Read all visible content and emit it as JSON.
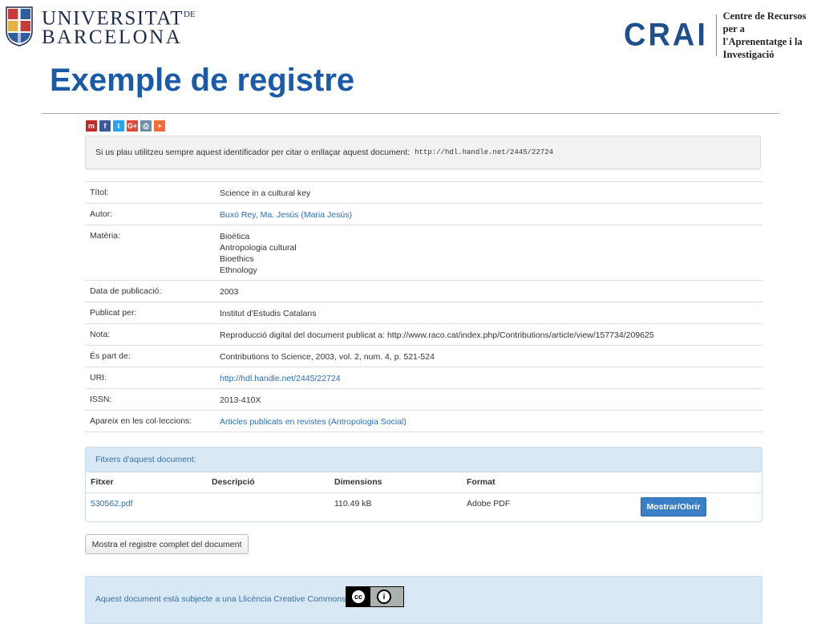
{
  "header": {
    "ub_line1": "UNIVERSITAT",
    "ub_de": "DE",
    "ub_line2": "BARCELONA",
    "crai_word": "CRAI",
    "crai_sub1": "Centre de Recursos per a",
    "crai_sub2": "l'Aprenentatge i la Investigació"
  },
  "title": "Exemple de registre",
  "share_icons": [
    {
      "name": "mendeley-icon",
      "glyph": "m",
      "color": "#c02a2a"
    },
    {
      "name": "facebook-icon",
      "glyph": "f",
      "color": "#3b5998"
    },
    {
      "name": "twitter-icon",
      "glyph": "t",
      "color": "#2aa3ef"
    },
    {
      "name": "googleplus-icon",
      "glyph": "G+",
      "color": "#dd4b39"
    },
    {
      "name": "print-icon",
      "glyph": "⎙",
      "color": "#6b8fa6"
    },
    {
      "name": "more-icon",
      "glyph": "+",
      "color": "#f26b38"
    }
  ],
  "identifier": {
    "text": "Si us plau utilitzeu sempre aquest identificador per citar o enllaçar aquest document:",
    "url": "http://hdl.handle.net/2445/22724"
  },
  "metadata": [
    {
      "label": "Títol:",
      "values": [
        "Science in a cultural key"
      ]
    },
    {
      "label": "Autor:",
      "values": [
        "Buxó Rey, Ma. Jesús (Maria Jesús)"
      ],
      "link": true
    },
    {
      "label": "Matèria:",
      "values": [
        "Bioètica",
        "Antropologia cultural",
        "Bioethics",
        "Ethnology"
      ]
    },
    {
      "label": "Data de publicació:",
      "values": [
        "2003"
      ]
    },
    {
      "label": "Publicat per:",
      "values": [
        "Institut d'Estudis Catalans"
      ]
    },
    {
      "label": "Nota:",
      "values": [
        "Reproducció digital del document publicat a: http://www.raco.cat/index.php/Contributions/article/view/157734/209625"
      ]
    },
    {
      "label": "És part de:",
      "values": [
        "Contributions to Science, 2003, vol. 2, num. 4, p. 521-524"
      ]
    },
    {
      "label": "URI:",
      "values": [
        "http://hdl.handle.net/2445/22724"
      ],
      "link": true
    },
    {
      "label": "ISSN:",
      "values": [
        "2013-410X"
      ]
    },
    {
      "label": "Apareix en les col·leccions:",
      "values": [
        "Articles publicats en revistes (Antropologia Social)"
      ],
      "link": true
    }
  ],
  "files": {
    "heading": "Fitxers d'aquest document:",
    "columns": [
      "Fitxer",
      "Descripció",
      "Dimensions",
      "Format"
    ],
    "row": {
      "file": "530562.pdf",
      "description": "",
      "size": "110.49 kB",
      "format": "Adobe PDF"
    },
    "show_button": "Mostrar/Obrir"
  },
  "full_record_button": "Mostra el registre complet del document",
  "license": {
    "text": "Aquest document està subjecte a una Llicència Creative Commons",
    "badge_left": "cc",
    "badge_right": "BY"
  }
}
